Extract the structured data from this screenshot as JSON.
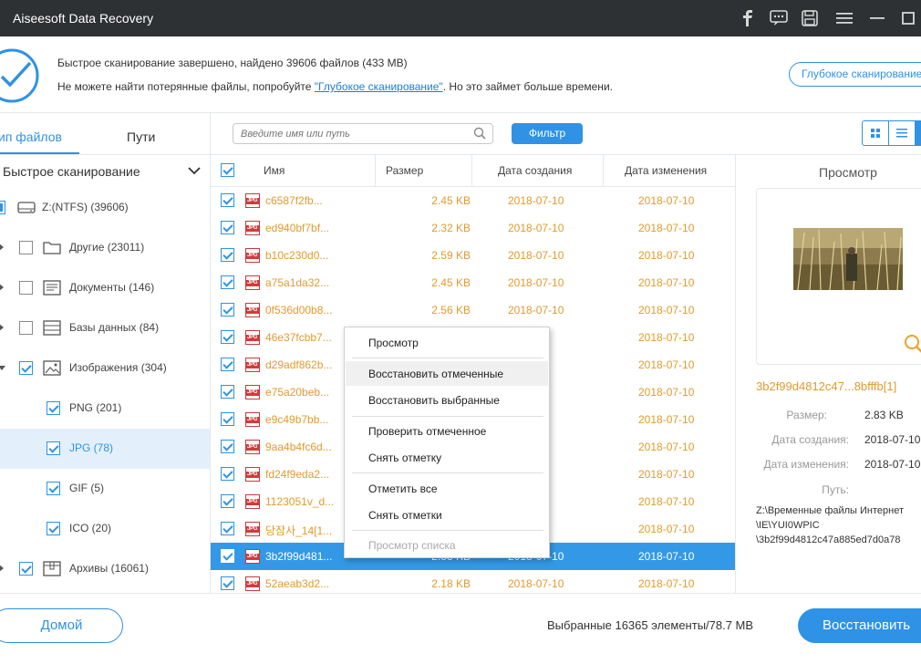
{
  "app": {
    "title": "Aiseesoft Data Recovery"
  },
  "titlebar_icons": [
    "facebook-icon",
    "feedback-icon",
    "save-icon",
    "menu-icon",
    "minimize-icon",
    "maximize-icon"
  ],
  "status": {
    "line1": "Быстрое сканирование завершено, найдено 39606 файлов (433 MB)",
    "line2_prefix": "Не можете найти потерянные файлы, попробуйте ",
    "line2_link": "\"Глубокое сканирование\"",
    "line2_suffix": ". Но это займет больше времени.",
    "deep_scan_button": "Глубокое сканирование"
  },
  "left_panel": {
    "tabs": [
      {
        "label": "ип файлов",
        "active": true
      },
      {
        "label": "Пути",
        "active": false
      }
    ],
    "scan_mode": "Быстрое сканирование",
    "tree": [
      {
        "label": "Z:(NTFS) (39606)",
        "checked": "partial",
        "icon": "drive-icon",
        "level": 0
      },
      {
        "label": "Другие (23011)",
        "checked": false,
        "icon": "folder-icon",
        "level": 1,
        "expand": "collapsed"
      },
      {
        "label": "Документы (146)",
        "checked": false,
        "icon": "document-icon",
        "level": 1,
        "expand": "collapsed"
      },
      {
        "label": "Базы данных (84)",
        "checked": false,
        "icon": "database-icon",
        "level": 1,
        "expand": "collapsed"
      },
      {
        "label": "Изображения (304)",
        "checked": true,
        "icon": "image-icon",
        "level": 1,
        "expand": "expanded"
      },
      {
        "label": "PNG (201)",
        "checked": true,
        "level": 2
      },
      {
        "label": "JPG (78)",
        "checked": true,
        "level": 2,
        "selected": true
      },
      {
        "label": "GIF (5)",
        "checked": true,
        "level": 2
      },
      {
        "label": "ICO (20)",
        "checked": true,
        "level": 2
      },
      {
        "label": "Архивы (16061)",
        "checked": true,
        "icon": "archive-icon",
        "level": 1,
        "expand": "collapsed"
      }
    ]
  },
  "toolbar": {
    "search_placeholder": "Введите имя или путь",
    "filter_button": "Фильтр"
  },
  "table": {
    "columns": [
      "Имя",
      "Размер",
      "Дата создания",
      "Дата изменения"
    ],
    "rows": [
      {
        "name": "c6587f2fb...",
        "size": "2.45 KB",
        "created": "2018-07-10",
        "modified": "2018-07-10"
      },
      {
        "name": "ed940bf7bf...",
        "size": "2.32 KB",
        "created": "2018-07-10",
        "modified": "2018-07-10"
      },
      {
        "name": "b10c230d0...",
        "size": "2.59 KB",
        "created": "2018-07-10",
        "modified": "2018-07-10"
      },
      {
        "name": "a75a1da32...",
        "size": "2.45 KB",
        "created": "2018-07-10",
        "modified": "2018-07-10"
      },
      {
        "name": "0f536d00b8...",
        "size": "2.56 KB",
        "created": "2018-07-10",
        "modified": "2018-07-10"
      },
      {
        "name": "46e37fcbb7...",
        "size": "",
        "created": "",
        "modified": "2018-07-10"
      },
      {
        "name": "d29adf862b...",
        "size": "",
        "created": "",
        "modified": "2018-07-10"
      },
      {
        "name": "e75a20beb...",
        "size": "",
        "created": "",
        "modified": "2018-07-10"
      },
      {
        "name": "e9c49b7bb...",
        "size": "",
        "created": "",
        "modified": "2018-07-10"
      },
      {
        "name": "9aa4b4fc6d...",
        "size": "",
        "created": "",
        "modified": "2018-07-10"
      },
      {
        "name": "fd24f9eda2...",
        "size": "",
        "created": "",
        "modified": "2018-07-10"
      },
      {
        "name": "1123051v_d...",
        "size": "",
        "created": "",
        "modified": "2018-07-10"
      },
      {
        "name": "당잠사_14[1...",
        "size": "",
        "created": "",
        "modified": "2018-07-10"
      },
      {
        "name": "3b2f99d481...",
        "size": "2.83 KB",
        "created": "2018-07-10",
        "modified": "2018-07-10",
        "selected": true
      },
      {
        "name": "52aeab3d2...",
        "size": "2.18 KB",
        "created": "2018-07-10",
        "modified": "2018-07-10"
      }
    ]
  },
  "context_menu": {
    "items": [
      {
        "label": "Просмотр",
        "disabled": false
      },
      {
        "label": "Восстановить отмеченные",
        "disabled": false,
        "hover": true
      },
      {
        "label": "Восстановить выбранные",
        "disabled": false
      },
      {
        "label": "Проверить отмеченное",
        "disabled": false
      },
      {
        "label": "Снять отметку",
        "disabled": false
      },
      {
        "label": "Отметить все",
        "disabled": false
      },
      {
        "label": "Снять отметки",
        "disabled": false
      },
      {
        "label": "Просмотр списка",
        "disabled": true
      }
    ]
  },
  "preview": {
    "title": "Просмотр",
    "filename": "3b2f99d4812c47...8bfffb[1]",
    "size_label": "Размер:",
    "size_value": "2.83 KB",
    "created_label": "Дата создания:",
    "created_value": "2018-07-10",
    "modified_label": "Дата изменения:",
    "modified_value": "2018-07-10",
    "path_label": "Путь:",
    "path_line1": "Z:\\Временные файлы Интернет",
    "path_line2": "\\IE\\YUI0WPIC",
    "path_line3": "\\3b2f99d4812c47a885ed7d0a78"
  },
  "bottom": {
    "home_button": "Домой",
    "selected_info": "Выбранные 16365 элементы/78.7 MB",
    "recover_button": "Восстановить"
  },
  "colors": {
    "accent": "#2f92e4",
    "file_text": "#e39a2c",
    "titlebar": "#2e3134",
    "row_selected": "#3399e6"
  }
}
